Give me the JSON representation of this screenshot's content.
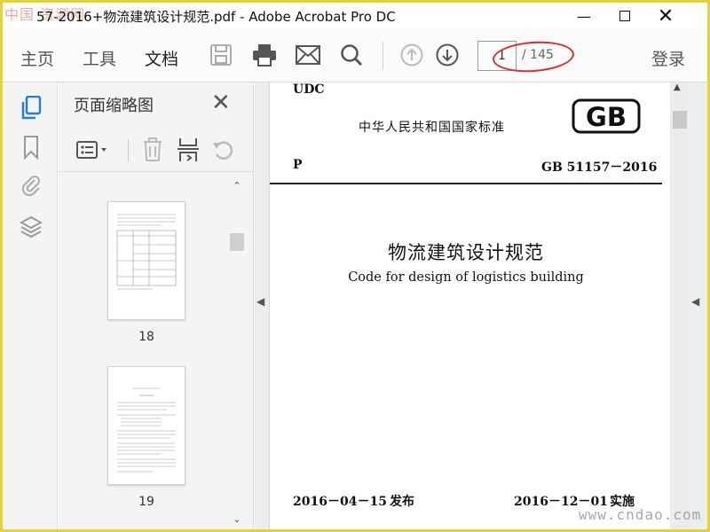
{
  "window": {
    "watermark_left": "中国 资源网",
    "title": "57-2016+物流建筑设计规范.pdf - Adobe Acrobat Pro DC",
    "min_label": "—",
    "close_label": "✕"
  },
  "toolbar": {
    "tabs": [
      "主页",
      "工具",
      "文档"
    ],
    "active_tab": "文档",
    "icons": [
      "save-icon",
      "print-icon",
      "email-icon",
      "search-icon",
      "page-up-icon",
      "page-down-icon"
    ],
    "current_page": "1",
    "total_pages": "/ 145",
    "login": "登录",
    "highlight_color": "#d8332a"
  },
  "left_rail": {
    "icons": [
      "page-thumbnails-icon",
      "bookmark-icon",
      "attachment-icon",
      "layers-icon"
    ],
    "accent": "#2a7dd1"
  },
  "thumbnails": {
    "title": "页面缩略图",
    "close": "✕",
    "tool_icons": [
      "options-menu-icon",
      "delete-icon",
      "insert-page-icon",
      "rotate-icon"
    ],
    "pages": [
      {
        "number": "18"
      },
      {
        "number": "19"
      }
    ]
  },
  "document": {
    "udc": "UDC",
    "standard_header": "中华人民共和国国家标准",
    "logo_text": "GB",
    "p_code": "P",
    "gb_number": "GB 51157－2016",
    "title_cn": "物流建筑设计规范",
    "title_en": "Code for design of logistics building",
    "publish_date": "2016－04－15",
    "publish_label": "发布",
    "implement_date": "2016－12－01",
    "implement_label": "实施"
  },
  "site_watermark": "www.cndao.com"
}
